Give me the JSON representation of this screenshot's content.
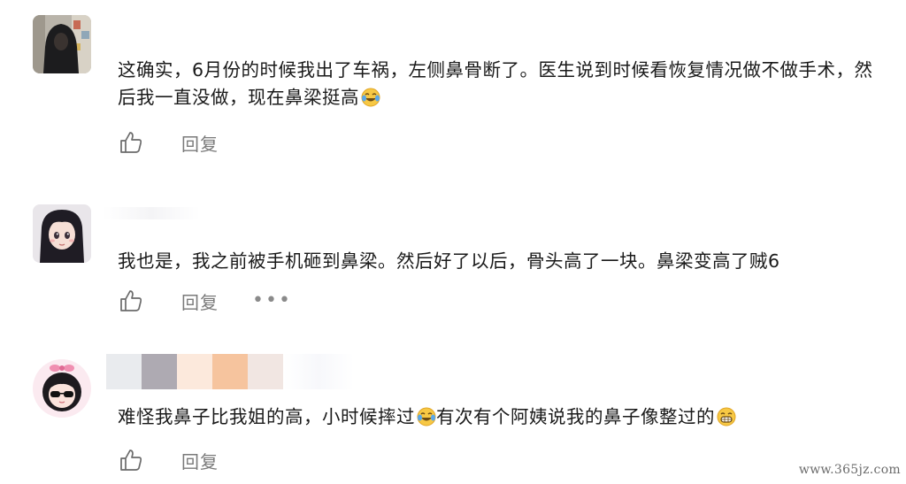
{
  "comments": [
    {
      "text": "这确实，6月份的时候我出了车祸，左侧鼻骨断了。医生说到时候看恢复情况做不做手术，然后我一直没做，现在鼻梁挺高",
      "emoji_icon": "crying-laughing-emoji",
      "reply_label": "回复"
    },
    {
      "text": "我也是，我之前被手机砸到鼻梁。然后好了以后，骨头高了一块。鼻梁变高了贼6",
      "reply_label": "回复",
      "more_label": "•••"
    },
    {
      "text_before_emoji": "难怪我鼻子比我姐的高，小时候摔过",
      "emoji1_icon": "crying-laughing-emoji",
      "text_after_emoji": "有次有个阿姨说我的鼻子像整过的",
      "emoji2_icon": "grinning-emoji",
      "reply_label": "回复"
    }
  ],
  "watermark": "www.365jz.com"
}
